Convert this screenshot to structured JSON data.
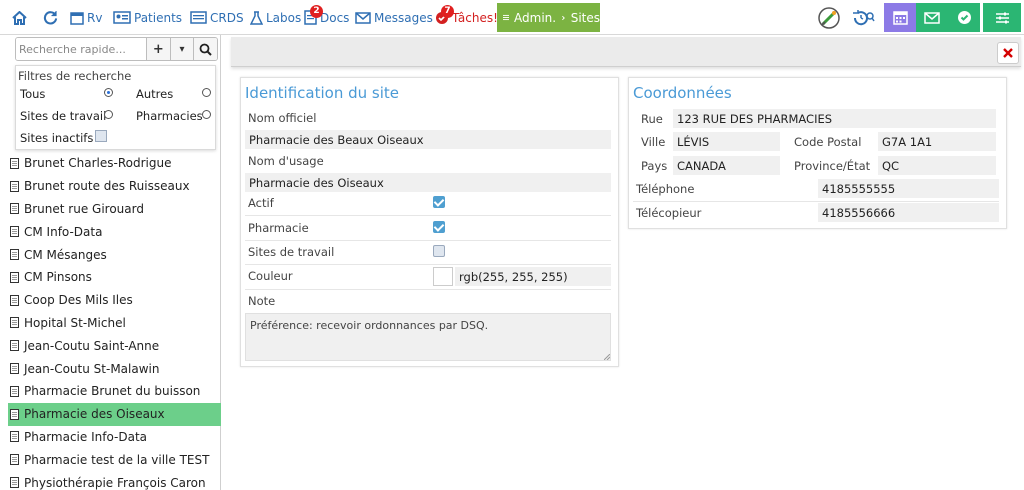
{
  "nav": {
    "rv": "Rv",
    "patients": "Patients",
    "crds": "CRDS",
    "labos": "Labos",
    "docs": "Docs",
    "docs_badge": "2",
    "messages": "Messages",
    "taches": "Tâches!",
    "taches_badge": "7",
    "admin": "Admin.",
    "sites": "Sites"
  },
  "search": {
    "placeholder": "Recherche rapide...",
    "add": "+",
    "dropdown": "▾",
    "search_icon": "⚲"
  },
  "filters": {
    "title": "Filtres de recherche",
    "tous": "Tous",
    "autres": "Autres",
    "sites_travail": "Sites de travail",
    "pharmacies": "Pharmacies",
    "sites_inactifs": "Sites inactifs"
  },
  "sites": [
    "Brunet Charles-Rodrigue",
    "Brunet route des Ruisseaux",
    "Brunet rue Girouard",
    "CM Info-Data",
    "CM Mésanges",
    "CM Pinsons",
    "Coop Des Mils Iles",
    "Hopital St-Michel",
    "Jean-Coutu Saint-Anne",
    "Jean-Coutu St-Malawin",
    "Pharmacie Brunet du buisson",
    "Pharmacie des Oiseaux",
    "Pharmacie Info-Data",
    "Pharmacie test de la ville TEST",
    "Physiothérapie François Caron"
  ],
  "selected_index": 11,
  "ident": {
    "title": "Identification du site",
    "nom_officiel_label": "Nom officiel",
    "nom_officiel": "Pharmacie des Beaux Oiseaux",
    "nom_usage_label": "Nom d'usage",
    "nom_usage": "Pharmacie des Oiseaux",
    "actif_label": "Actif",
    "pharmacie_label": "Pharmacie",
    "sites_travail_label": "Sites de travail",
    "couleur_label": "Couleur",
    "couleur_value": "rgb(255, 255, 255)",
    "note_label": "Note",
    "note": "Préférence: recevoir ordonnances par DSQ."
  },
  "coord": {
    "title": "Coordonnées",
    "rue_label": "Rue",
    "rue": "123 RUE DES PHARMACIES",
    "ville_label": "Ville",
    "ville": "LÉVIS",
    "cp_label": "Code Postal",
    "cp": "G7A 1A1",
    "pays_label": "Pays",
    "pays": "CANADA",
    "province_label": "Province/État",
    "province": "QC",
    "tel_label": "Téléphone",
    "tel": "4185555555",
    "fax_label": "Télécopieur",
    "fax": "4185556666"
  },
  "colors": {
    "accent": "#4a9ad6",
    "nav_link": "#2f6fb3",
    "admin_green": "#7cb342",
    "selected_row": "#6ccf8a",
    "purple_btn": "#8c7ae6",
    "teal_btn": "#2bb673"
  }
}
